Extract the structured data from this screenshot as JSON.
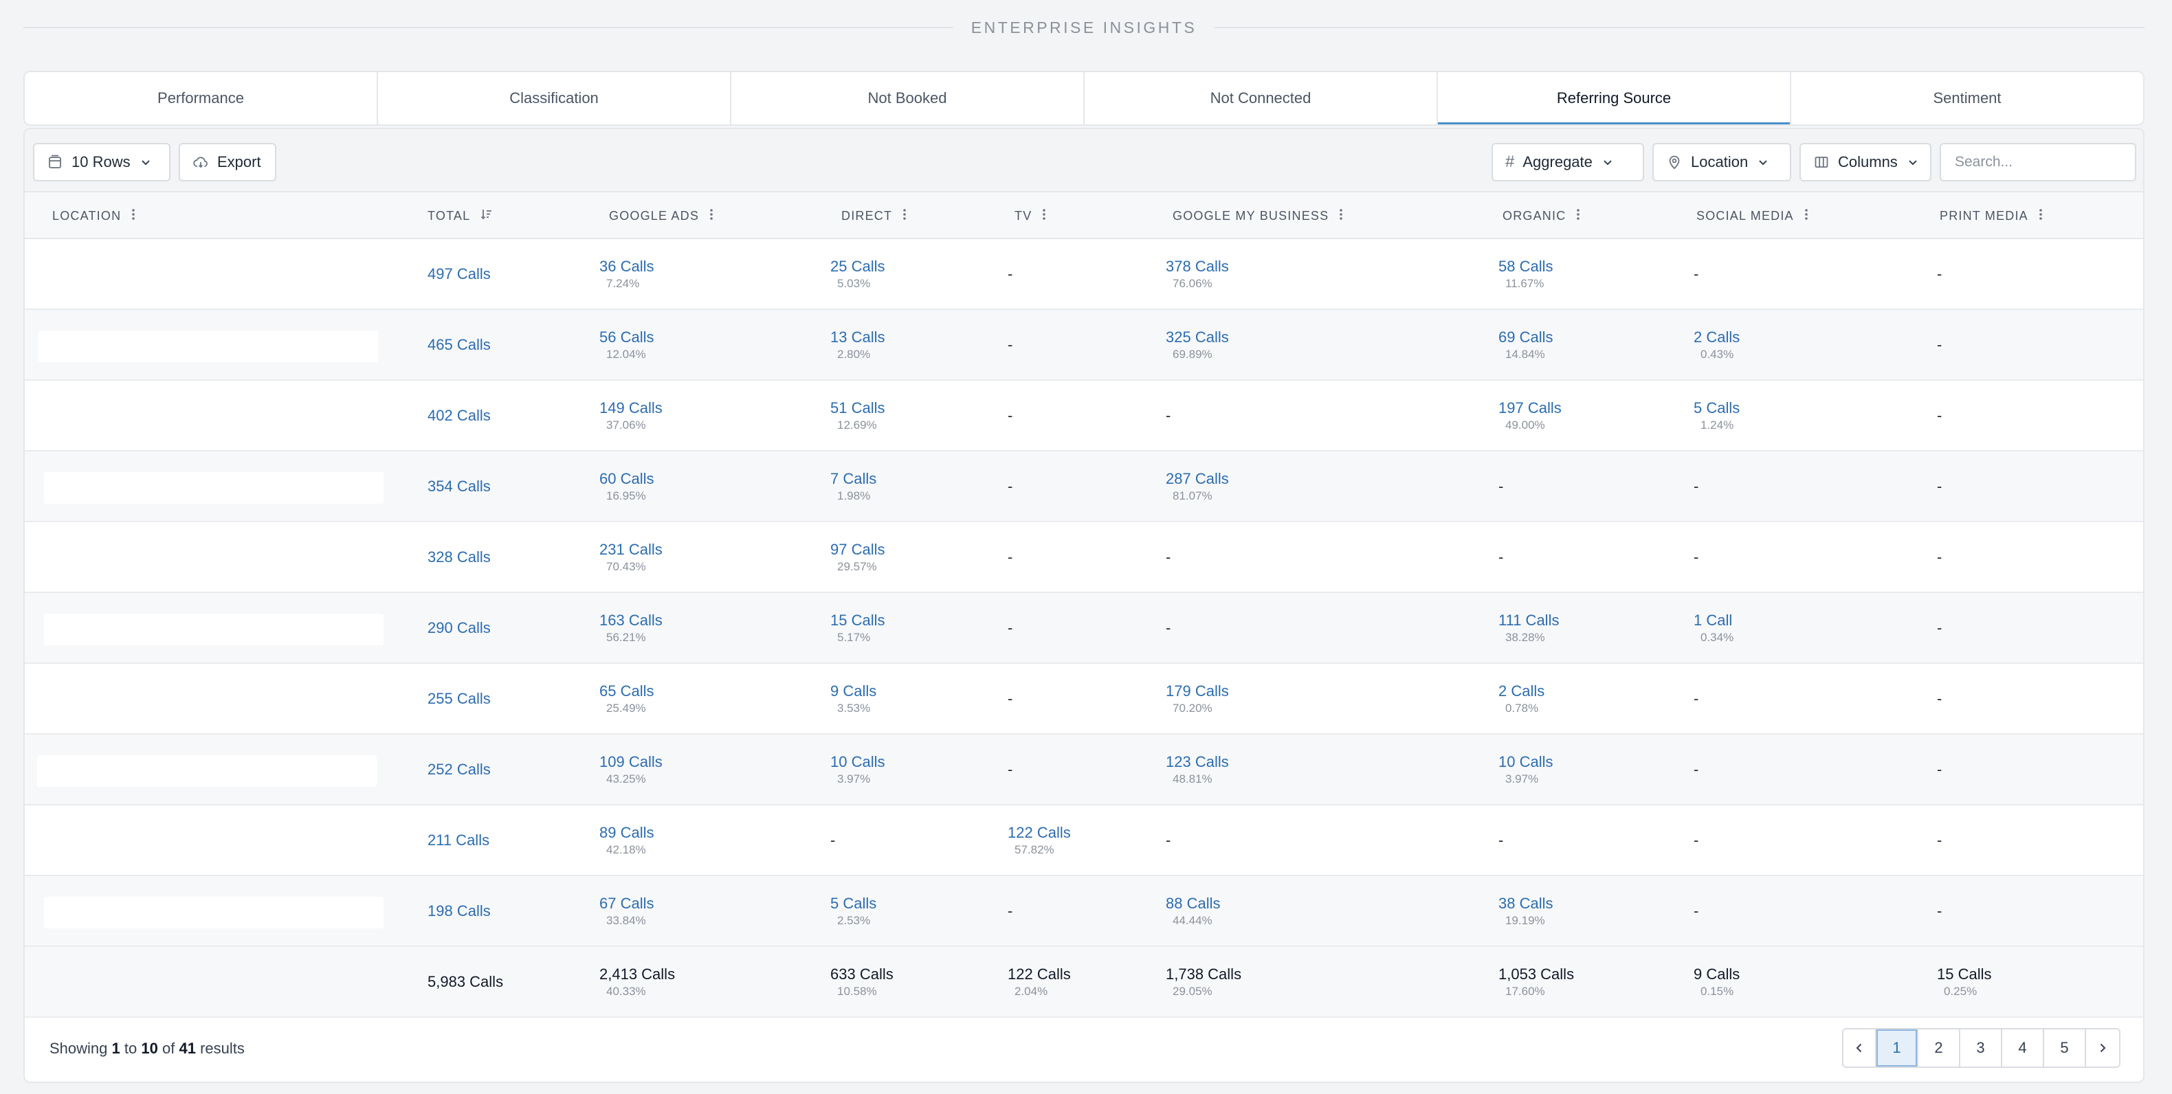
{
  "section_title": "ENTERPRISE INSIGHTS",
  "tabs": [
    {
      "label": "Performance",
      "active": false
    },
    {
      "label": "Classification",
      "active": false
    },
    {
      "label": "Not Booked",
      "active": false
    },
    {
      "label": "Not Connected",
      "active": false
    },
    {
      "label": "Referring Source",
      "active": true
    },
    {
      "label": "Sentiment",
      "active": false
    }
  ],
  "toolbar": {
    "rows_label": "10 Rows",
    "export_label": "Export",
    "aggregate_label": "Aggregate",
    "location_label": "Location",
    "columns_label": "Columns",
    "search_placeholder": "Search..."
  },
  "columns": [
    {
      "key": "location",
      "label": "LOCATION"
    },
    {
      "key": "total",
      "label": "TOTAL"
    },
    {
      "key": "google_ads",
      "label": "GOOGLE ADS"
    },
    {
      "key": "direct",
      "label": "DIRECT"
    },
    {
      "key": "tv",
      "label": "TV"
    },
    {
      "key": "gmb",
      "label": "GOOGLE MY BUSINESS"
    },
    {
      "key": "organic",
      "label": "ORGANIC"
    },
    {
      "key": "social",
      "label": "SOCIAL MEDIA"
    },
    {
      "key": "print",
      "label": "PRINT MEDIA"
    }
  ],
  "rows": [
    {
      "total": "497 Calls",
      "cells": [
        [
          "36 Calls",
          "7.24%"
        ],
        [
          "25 Calls",
          "5.03%"
        ],
        [
          "-",
          ""
        ],
        [
          "378 Calls",
          "76.06%"
        ],
        [
          "58 Calls",
          "11.67%"
        ],
        [
          "-",
          ""
        ],
        [
          "-",
          ""
        ]
      ]
    },
    {
      "total": "465 Calls",
      "cells": [
        [
          "56 Calls",
          "12.04%"
        ],
        [
          "13 Calls",
          "2.80%"
        ],
        [
          "-",
          ""
        ],
        [
          "325 Calls",
          "69.89%"
        ],
        [
          "69 Calls",
          "14.84%"
        ],
        [
          "2 Calls",
          "0.43%"
        ],
        [
          "-",
          ""
        ]
      ]
    },
    {
      "total": "402 Calls",
      "cells": [
        [
          "149 Calls",
          "37.06%"
        ],
        [
          "51 Calls",
          "12.69%"
        ],
        [
          "-",
          ""
        ],
        [
          "-",
          ""
        ],
        [
          "197 Calls",
          "49.00%"
        ],
        [
          "5 Calls",
          "1.24%"
        ],
        [
          "-",
          ""
        ]
      ]
    },
    {
      "total": "354 Calls",
      "cells": [
        [
          "60 Calls",
          "16.95%"
        ],
        [
          "7 Calls",
          "1.98%"
        ],
        [
          "-",
          ""
        ],
        [
          "287 Calls",
          "81.07%"
        ],
        [
          "-",
          ""
        ],
        [
          "-",
          ""
        ],
        [
          "-",
          ""
        ]
      ]
    },
    {
      "total": "328 Calls",
      "cells": [
        [
          "231 Calls",
          "70.43%"
        ],
        [
          "97 Calls",
          "29.57%"
        ],
        [
          "-",
          ""
        ],
        [
          "-",
          ""
        ],
        [
          "-",
          ""
        ],
        [
          "-",
          ""
        ],
        [
          "-",
          ""
        ]
      ]
    },
    {
      "total": "290 Calls",
      "cells": [
        [
          "163 Calls",
          "56.21%"
        ],
        [
          "15 Calls",
          "5.17%"
        ],
        [
          "-",
          ""
        ],
        [
          "-",
          ""
        ],
        [
          "111 Calls",
          "38.28%"
        ],
        [
          "1 Call",
          "0.34%"
        ],
        [
          "-",
          ""
        ]
      ]
    },
    {
      "total": "255 Calls",
      "cells": [
        [
          "65 Calls",
          "25.49%"
        ],
        [
          "9 Calls",
          "3.53%"
        ],
        [
          "-",
          ""
        ],
        [
          "179 Calls",
          "70.20%"
        ],
        [
          "2 Calls",
          "0.78%"
        ],
        [
          "-",
          ""
        ],
        [
          "-",
          ""
        ]
      ]
    },
    {
      "total": "252 Calls",
      "cells": [
        [
          "109 Calls",
          "43.25%"
        ],
        [
          "10 Calls",
          "3.97%"
        ],
        [
          "-",
          ""
        ],
        [
          "123 Calls",
          "48.81%"
        ],
        [
          "10 Calls",
          "3.97%"
        ],
        [
          "-",
          ""
        ],
        [
          "-",
          ""
        ]
      ]
    },
    {
      "total": "211 Calls",
      "cells": [
        [
          "89 Calls",
          "42.18%"
        ],
        [
          "-",
          ""
        ],
        [
          "122 Calls",
          "57.82%"
        ],
        [
          "-",
          ""
        ],
        [
          "-",
          ""
        ],
        [
          "-",
          ""
        ],
        [
          "-",
          ""
        ]
      ]
    },
    {
      "total": "198 Calls",
      "cells": [
        [
          "67 Calls",
          "33.84%"
        ],
        [
          "5 Calls",
          "2.53%"
        ],
        [
          "-",
          ""
        ],
        [
          "88 Calls",
          "44.44%"
        ],
        [
          "38 Calls",
          "19.19%"
        ],
        [
          "-",
          ""
        ],
        [
          "-",
          ""
        ]
      ]
    }
  ],
  "totals": {
    "total": "5,983 Calls",
    "cells": [
      [
        "2,413 Calls",
        "40.33%"
      ],
      [
        "633 Calls",
        "10.58%"
      ],
      [
        "122 Calls",
        "2.04%"
      ],
      [
        "1,738 Calls",
        "29.05%"
      ],
      [
        "1,053 Calls",
        "17.60%"
      ],
      [
        "9 Calls",
        "0.15%"
      ],
      [
        "15 Calls",
        "0.25%"
      ]
    ]
  },
  "footer": {
    "prefix": "Showing",
    "from": "1",
    "to_word": "to",
    "to": "10",
    "of_word": "of",
    "count": "41",
    "suffix": "results"
  },
  "pagination": {
    "pages": [
      "1",
      "2",
      "3",
      "4",
      "5"
    ],
    "current": "1"
  },
  "colors": {
    "link": "#2b6cb0",
    "accent": "#4a90c9"
  }
}
